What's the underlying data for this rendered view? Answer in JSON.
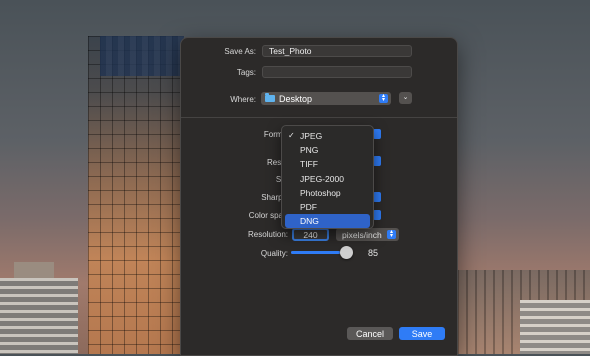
{
  "dialog": {
    "save_as_label": "Save As:",
    "save_as_value": "Test_Photo",
    "tags_label": "Tags:",
    "tags_value": "",
    "where_label": "Where:",
    "where_value": "Desktop"
  },
  "options": {
    "format_label": "Forma",
    "resize_label": "Resiz",
    "size_label": "Siz",
    "sharpen_label": "Sharpe",
    "color_space_label": "Color spac",
    "resolution_label": "Resolution:",
    "resolution_value": "240",
    "resolution_unit": "pixels/inch",
    "quality_label": "Quality:",
    "quality_value": "85",
    "quality_fraction": 0.85
  },
  "format_menu": {
    "items": [
      "JPEG",
      "PNG",
      "TIFF",
      "JPEG-2000",
      "Photoshop",
      "PDF",
      "DNG"
    ],
    "checked": "JPEG",
    "highlighted": "DNG",
    "check_mark": "✓"
  },
  "buttons": {
    "cancel": "Cancel",
    "save": "Save"
  },
  "colors": {
    "accent": "#2f7cf6",
    "menu_highlight": "#2f63c8",
    "dialog_bg": "#2c2a29"
  }
}
